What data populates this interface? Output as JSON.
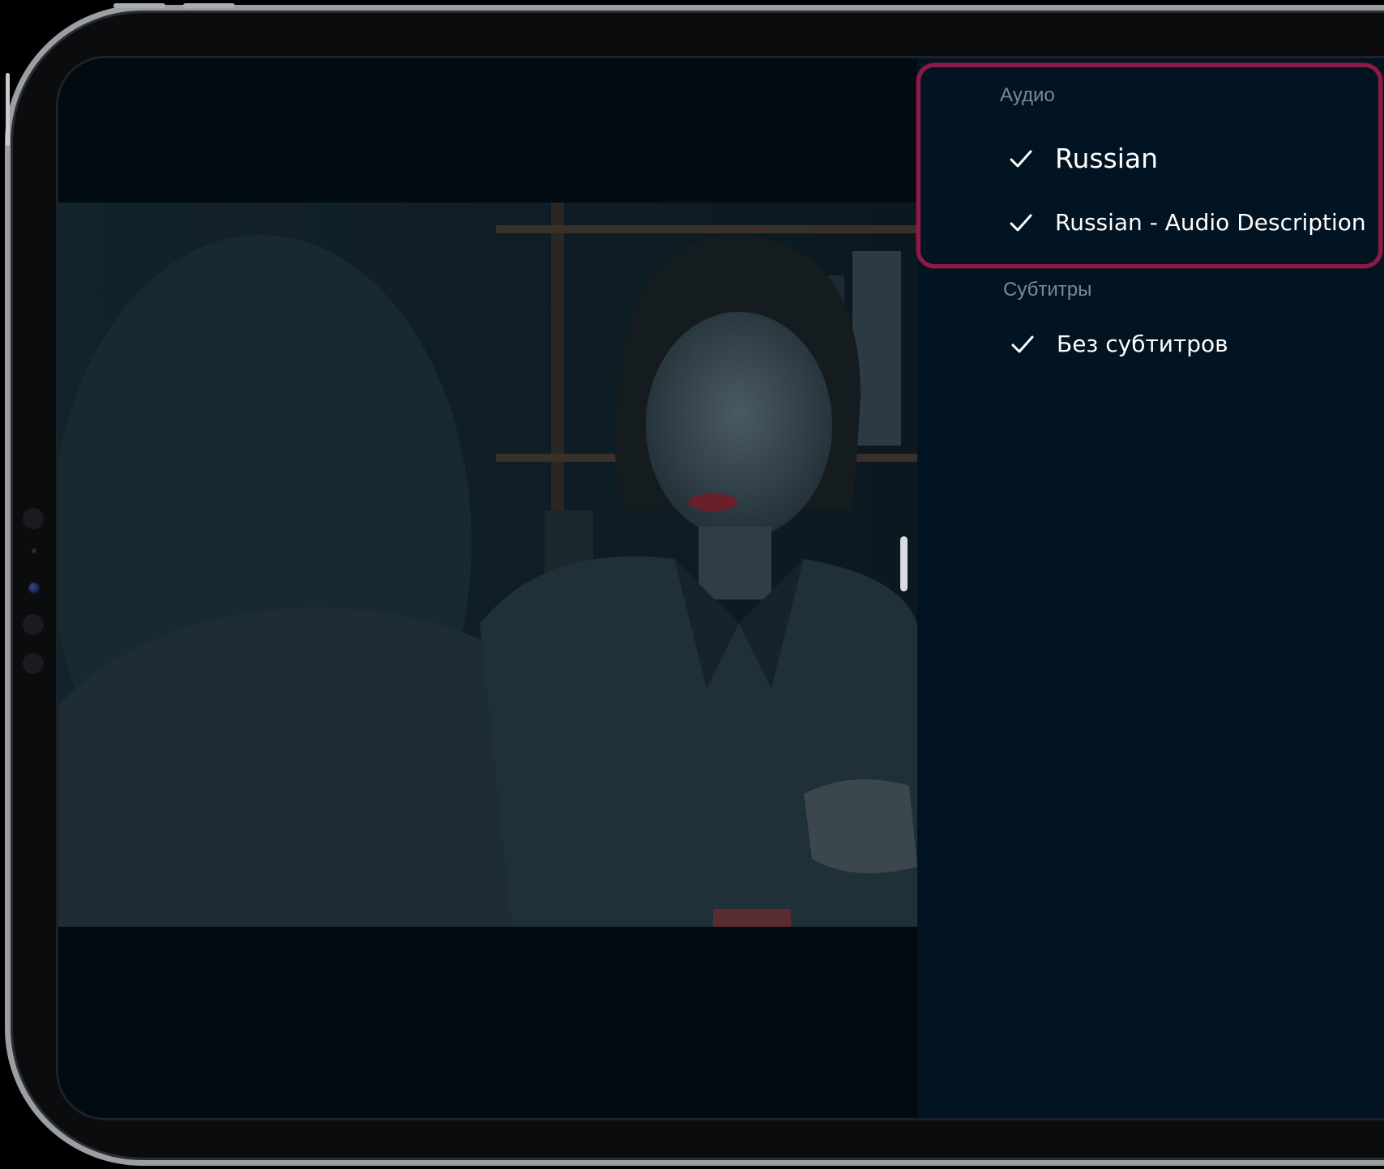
{
  "audio": {
    "section_label": "Аудио",
    "options": [
      {
        "label": "Russian",
        "selected": true
      },
      {
        "label": "Russian - Audio Description",
        "selected": true
      }
    ]
  },
  "subtitles": {
    "section_label": "Субтитры",
    "options": [
      {
        "label": "Без субтитров",
        "selected": true
      }
    ]
  },
  "colors": {
    "panel_background": "#021321",
    "highlight_border": "#8f1a4a",
    "section_label": "#7e8893",
    "option_text": "#ffffff"
  },
  "icons": {
    "selected_marker": "check-icon"
  }
}
